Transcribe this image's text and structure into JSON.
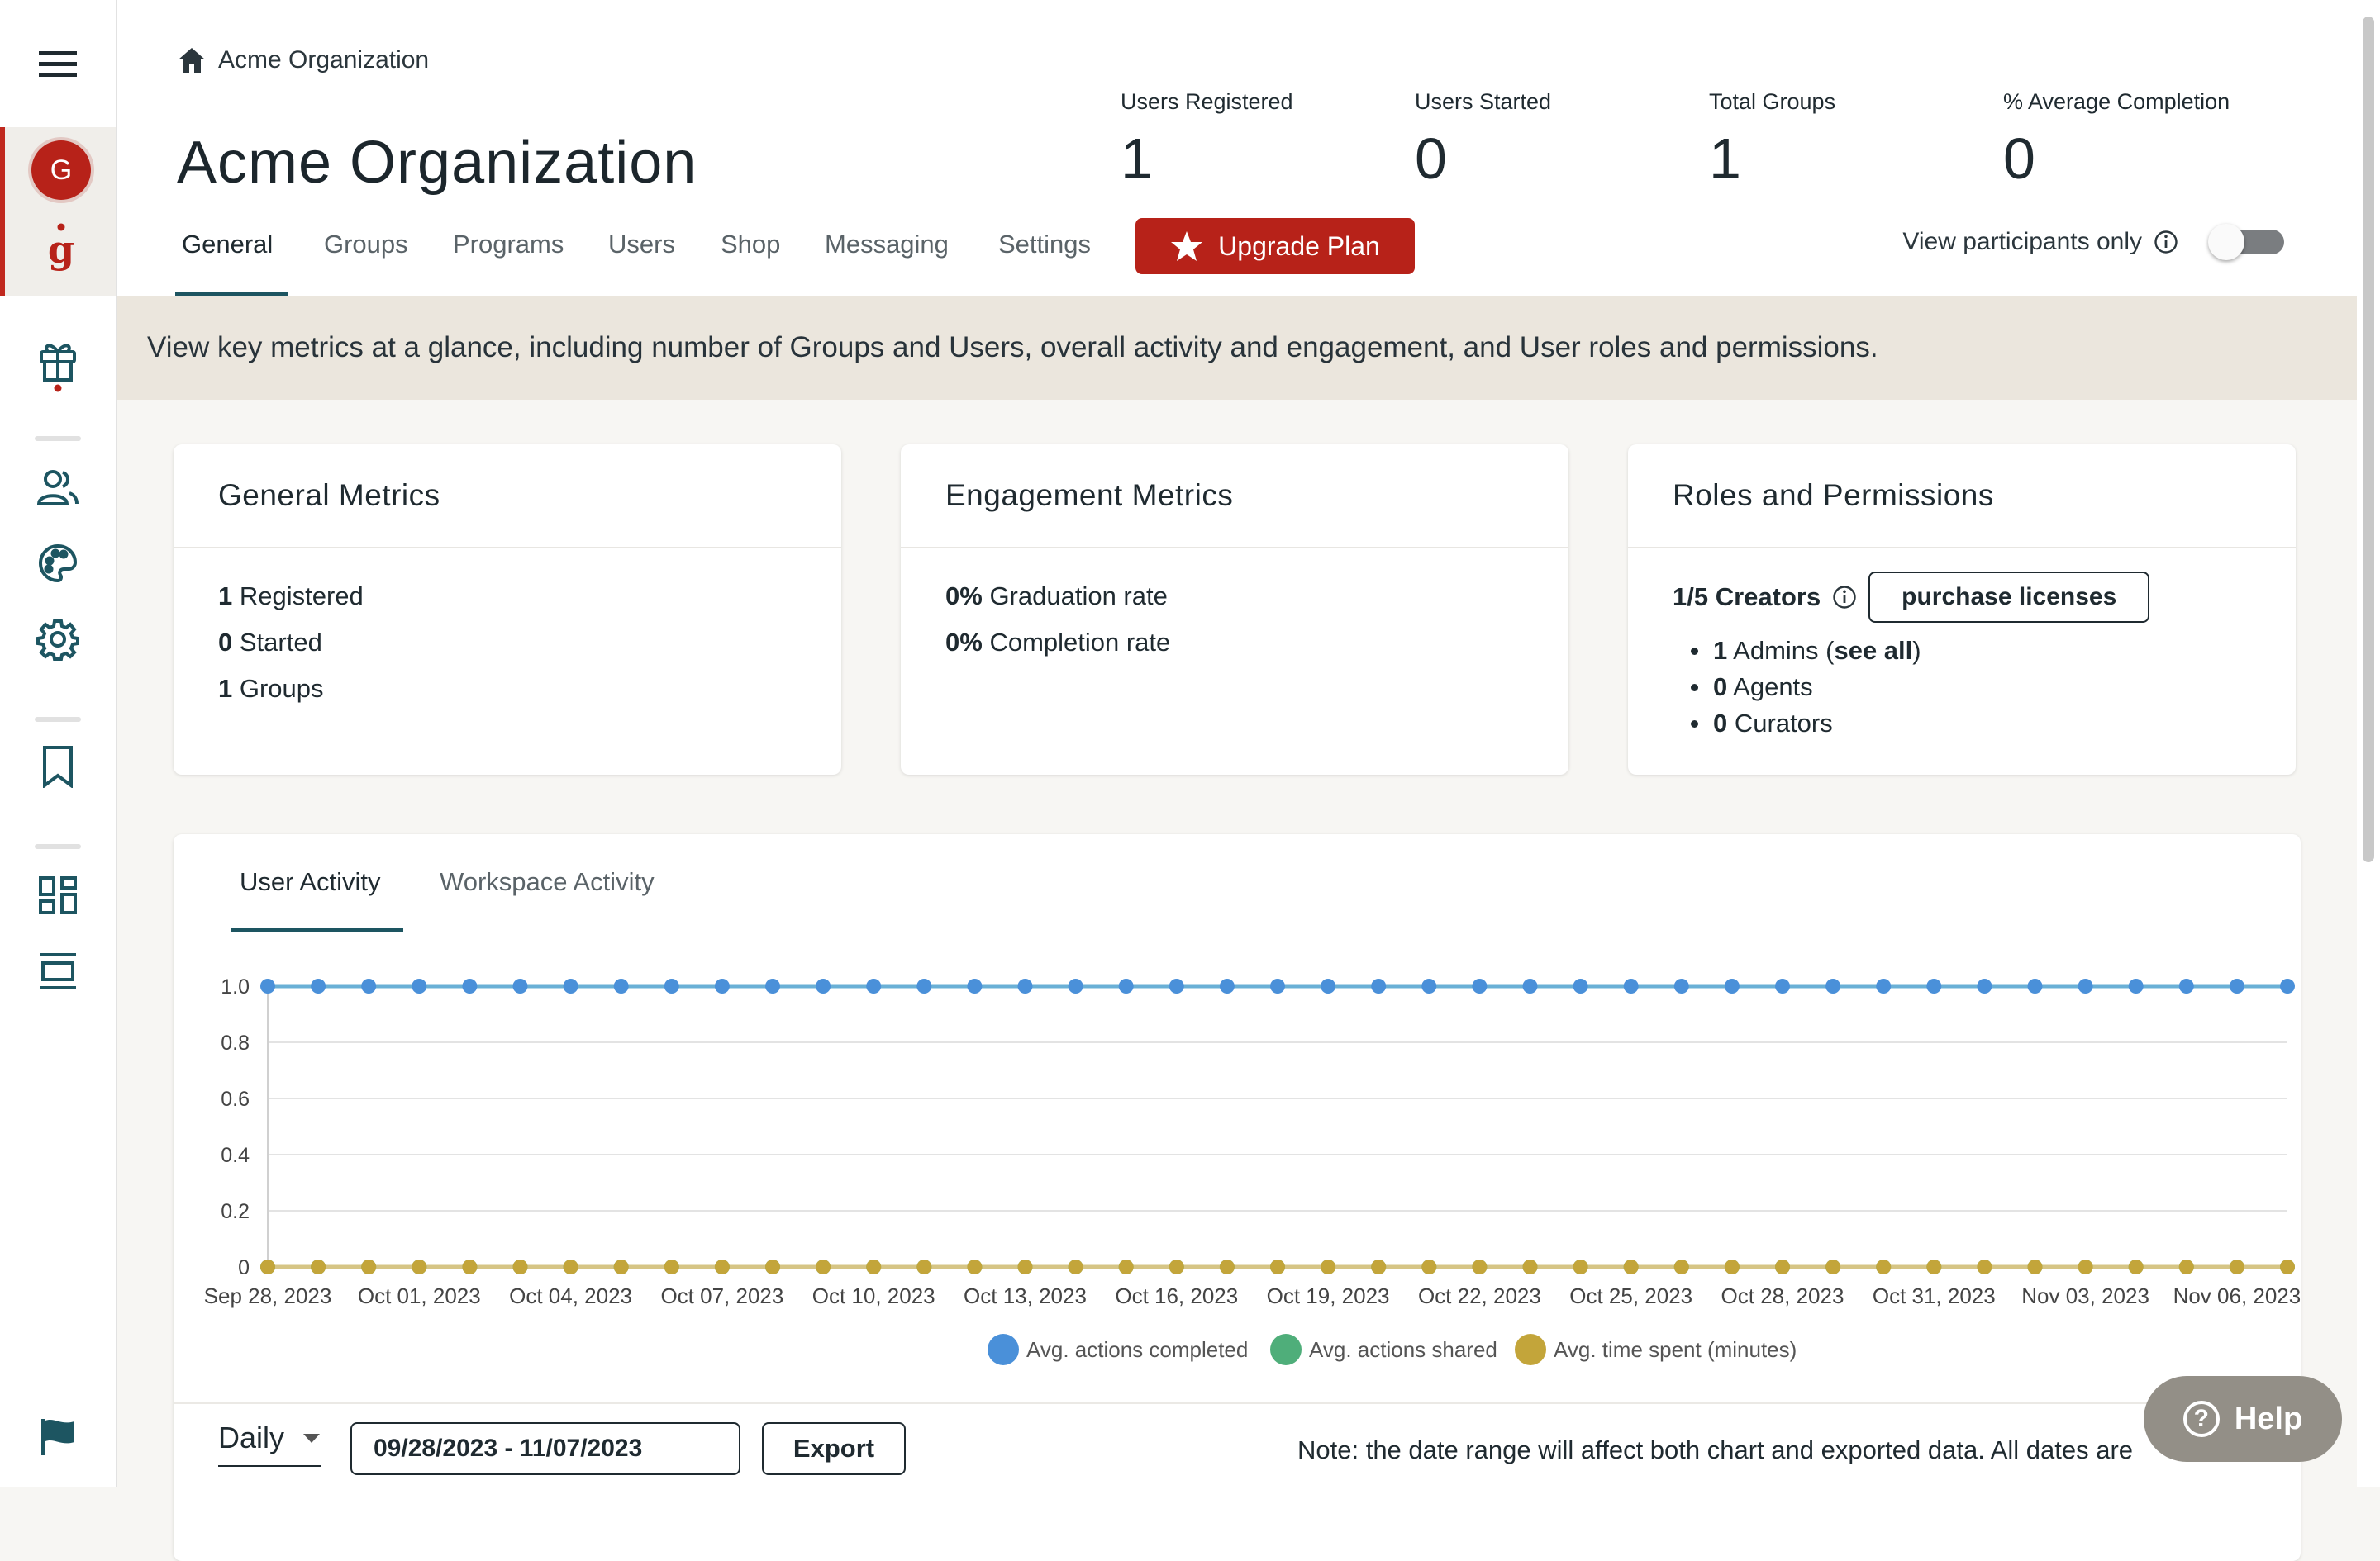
{
  "sidebar": {
    "avatar_initial": "G",
    "brand_letter": "g",
    "items": [
      {
        "name": "menu-icon"
      },
      {
        "name": "gift-icon"
      },
      {
        "name": "users-icon"
      },
      {
        "name": "palette-icon"
      },
      {
        "name": "gear-icon"
      },
      {
        "name": "bookmark-icon"
      },
      {
        "name": "dashboard-icon"
      },
      {
        "name": "layout-icon"
      },
      {
        "name": "flag-icon"
      }
    ]
  },
  "header": {
    "breadcrumb": "Acme Organization",
    "title": "Acme Organization",
    "stats": [
      {
        "label": "Users Registered",
        "value": "1"
      },
      {
        "label": "Users Started",
        "value": "0"
      },
      {
        "label": "Total Groups",
        "value": "1"
      },
      {
        "label": "% Average Completion",
        "value": "0"
      }
    ],
    "tabs": [
      "General",
      "Groups",
      "Programs",
      "Users",
      "Shop",
      "Messaging",
      "Settings"
    ],
    "upgrade_label": "Upgrade Plan",
    "view_participants_label": "View participants only",
    "toggle_on": false
  },
  "banner": "View key metrics at a glance, including number of Groups and Users, overall activity and engagement, and User roles and permissions.",
  "cards": {
    "general": {
      "title": "General Metrics",
      "lines": [
        {
          "num": "1",
          "text": "Registered"
        },
        {
          "num": "0",
          "text": "Started"
        },
        {
          "num": "1",
          "text": "Groups"
        }
      ]
    },
    "engagement": {
      "title": "Engagement Metrics",
      "lines": [
        {
          "num": "0%",
          "text": "Graduation rate"
        },
        {
          "num": "0%",
          "text": "Completion rate"
        }
      ]
    },
    "roles": {
      "title": "Roles and Permissions",
      "creators": "1/5 Creators",
      "purchase_label": "purchase licenses",
      "admins_num": "1",
      "admins_text": "Admins (",
      "see_all": "see all",
      "admins_close": ")",
      "agents_num": "0",
      "agents_text": "Agents",
      "curators_num": "0",
      "curators_text": "Curators"
    }
  },
  "activity": {
    "tabs": [
      "User Activity",
      "Workspace Activity"
    ],
    "period": "Daily",
    "date_range": "09/28/2023 - 11/07/2023",
    "export_label": "Export",
    "note": "Note: the date range will affect both chart and exported data. All dates are"
  },
  "help_label": "Help",
  "colors": {
    "brand_red": "#b72219",
    "teal": "#1d5561",
    "series_blue": "#4a90d9",
    "series_green": "#4fae7a",
    "series_gold": "#c3a53a"
  },
  "chart_data": {
    "type": "line",
    "x_start": "Sep 28, 2023",
    "x_tick_labels": [
      "Sep 28, 2023",
      "Oct 01, 2023",
      "Oct 04, 2023",
      "Oct 07, 2023",
      "Oct 10, 2023",
      "Oct 13, 2023",
      "Oct 16, 2023",
      "Oct 19, 2023",
      "Oct 22, 2023",
      "Oct 25, 2023",
      "Oct 28, 2023",
      "Oct 31, 2023",
      "Nov 03, 2023",
      "Nov 06, 2023"
    ],
    "ylim": [
      0,
      1.0
    ],
    "y_ticks": [
      "0",
      "0.2",
      "0.4",
      "0.6",
      "0.8",
      "1.0"
    ],
    "grid": true,
    "legend": "bottom",
    "series": [
      {
        "name": "Avg. actions completed",
        "color": "#4a90d9",
        "values": [
          1,
          1,
          1,
          1,
          1,
          1,
          1,
          1,
          1,
          1,
          1,
          1,
          1,
          1,
          1,
          1,
          1,
          1,
          1,
          1,
          1,
          1,
          1,
          1,
          1,
          1,
          1,
          1,
          1,
          1,
          1,
          1,
          1,
          1,
          1,
          1,
          1,
          1,
          1,
          1,
          1
        ]
      },
      {
        "name": "Avg. actions shared",
        "color": "#4fae7a",
        "values": [
          0,
          0,
          0,
          0,
          0,
          0,
          0,
          0,
          0,
          0,
          0,
          0,
          0,
          0,
          0,
          0,
          0,
          0,
          0,
          0,
          0,
          0,
          0,
          0,
          0,
          0,
          0,
          0,
          0,
          0,
          0,
          0,
          0,
          0,
          0,
          0,
          0,
          0,
          0,
          0,
          0
        ]
      },
      {
        "name": "Avg. time spent (minutes)",
        "color": "#c3a53a",
        "values": [
          0,
          0,
          0,
          0,
          0,
          0,
          0,
          0,
          0,
          0,
          0,
          0,
          0,
          0,
          0,
          0,
          0,
          0,
          0,
          0,
          0,
          0,
          0,
          0,
          0,
          0,
          0,
          0,
          0,
          0,
          0,
          0,
          0,
          0,
          0,
          0,
          0,
          0,
          0,
          0,
          0
        ]
      }
    ]
  }
}
